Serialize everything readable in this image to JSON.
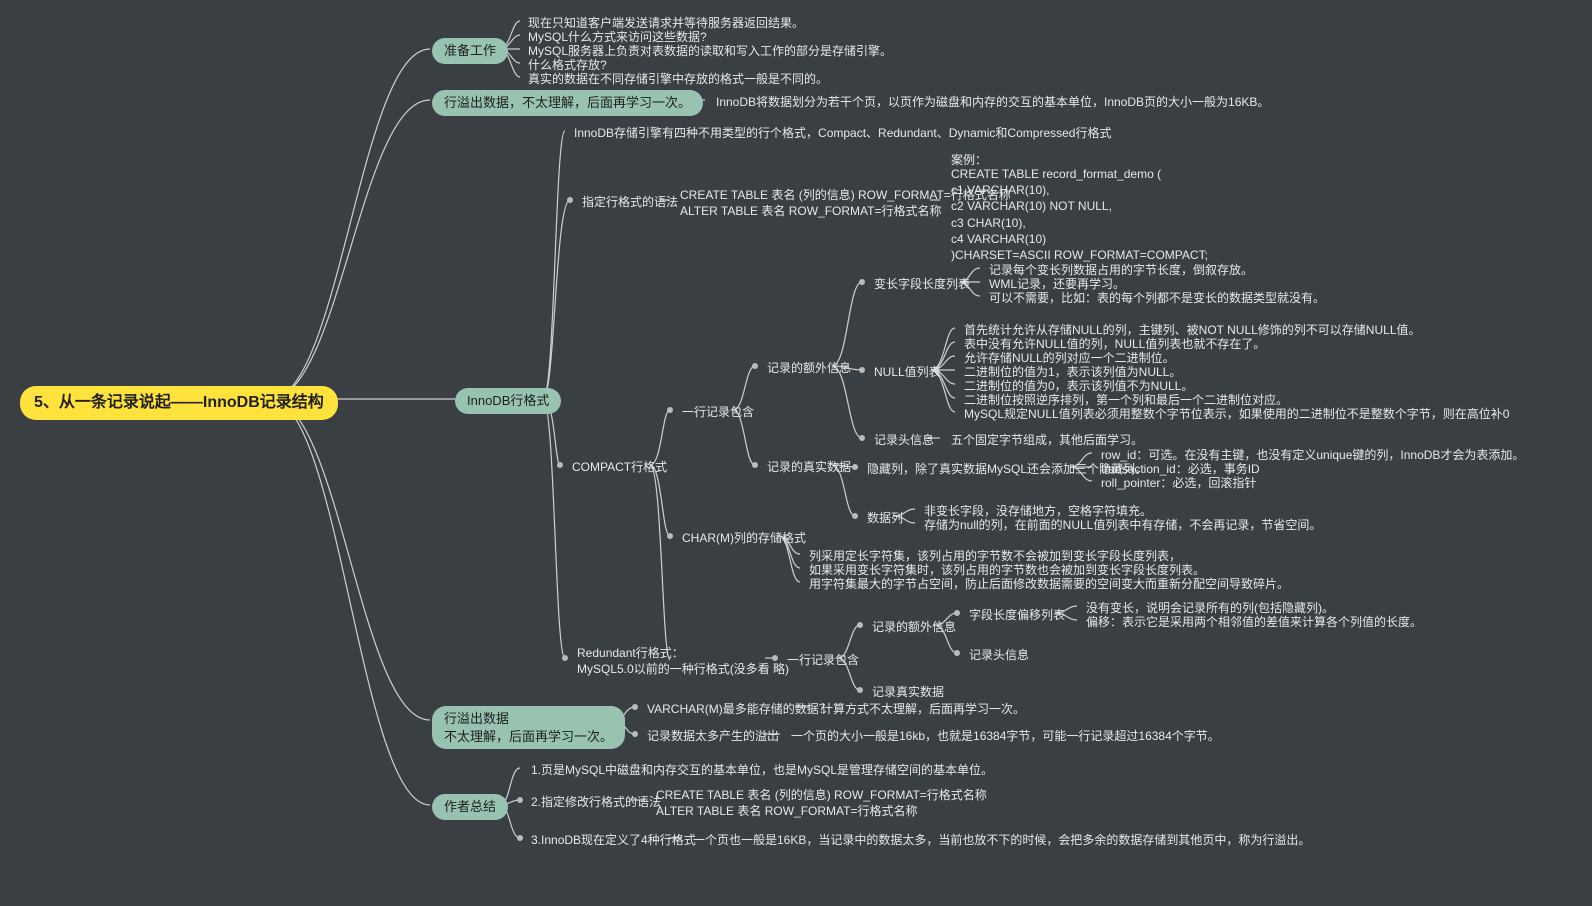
{
  "root": "5、从一条记录说起——InnoDB记录结构",
  "b1": {
    "title": "准备工作",
    "lines": [
      "现在只知道客户端发送请求并等待服务器返回结果。",
      "MySQL什么方式来访问这些数据?",
      "MySQL服务器上负责对表数据的读取和写入工作的部分是存储引擎。",
      "什么格式存放?",
      "真实的数据在不同存储引擎中存放的格式一般是不同的。"
    ]
  },
  "b2": {
    "title": "行溢出数据，不太理解，后面再学习一次。",
    "text": "InnoDB将数据划分为若干个页，以页作为磁盘和内存的交互的基本单位，InnoDB页的大小一般为16KB。"
  },
  "b3": {
    "title": "InnoDB行格式",
    "intro": "InnoDB存储引擎有四种不用类型的行个格式，Compact、Redundant、Dynamic和Compressed行格式",
    "syntax": {
      "title": "指定行格式的语法",
      "lines": "CREATE TABLE 表名 (列的信息) ROW_FORMAT=行格式名称\nALTER TABLE 表名 ROW_FORMAT=行格式名称",
      "example_label": "案例：",
      "example": "CREATE TABLE record_format_demo (\nc1 VARCHAR(10),\nc2 VARCHAR(10) NOT NULL,\nc3 CHAR(10),\nc4 VARCHAR(10)\n)CHARSET=ASCII ROW_FORMAT=COMPACT;"
    },
    "compact": {
      "title": "COMPACT行格式",
      "row_contains": "一行记录包含",
      "extra": "记录的额外信息",
      "varlen": {
        "title": "变长字段长度列表",
        "lines": [
          "记录每个变长列数据占用的字节长度，倒叙存放。",
          "WML记录，还要再学习。",
          "可以不需要，比如：表的每个列都不是变长的数据类型就没有。"
        ]
      },
      "nulls": {
        "title": "NULL值列表",
        "lines": [
          "首先统计允许从存储NULL的列，主键列、被NOT NULL修饰的列不可以存储NULL值。",
          "表中没有允许NULL值的列，NULL值列表也就不存在了。",
          "允许存储NULL的列对应一个二进制位。",
          "二进制位的值为1，表示该列值为NULL。",
          "二进制位的值为0，表示该列值不为NULL。",
          "二进制位按照逆序排列，第一个列和最后一个二进制位对应。",
          "MySQL规定NULL值列表必须用整数个字节位表示，如果使用的二进制位不是整数个字节，则在高位补0"
        ]
      },
      "header": {
        "title": "记录头信息",
        "text": "五个固定字节组成，其他后面学习。"
      },
      "real": {
        "title": "记录的真实数据",
        "hidden": {
          "title": "隐藏列，除了真实数据MySQL还会添加三个隐藏列。",
          "lines": [
            "row_id：可选。在没有主键，也没有定义unique键的列，InnoDB才会为表添加。",
            "transaction_id：必选，事务ID",
            "roll_pointer：必选，回滚指针"
          ]
        },
        "datacol": {
          "title": "数据列",
          "lines": [
            "非变长字段，没存储地方，空格字符填充。",
            "存储为null的列，在前面的NULL值列表中有存储，不会再记录，节省空间。"
          ]
        }
      },
      "charm": {
        "title": "CHAR(M)列的存储格式",
        "lines": [
          "列采用定长字符集，该列占用的字节数不会被加到变长字段长度列表，",
          "如果采用变长字符集时，该列占用的字节数也会被加到变长字段长度列表。",
          "用字符集最大的字节占空间，防止后面修改数据需要的空间变大而重新分配空间导致碎片。"
        ]
      }
    },
    "redundant": {
      "title": "Redundant行格式：\nMySQL5.0以前的一种行格式(没多看 略)",
      "row_contains": "一行记录包含",
      "extra": "记录的额外信息",
      "offset": {
        "title": "字段长度偏移列表",
        "lines": [
          "没有变长，说明会记录所有的列(包括隐藏列)。",
          "偏移：表示它是采用两个相邻值的差值来计算各个列值的长度。"
        ]
      },
      "header": "记录头信息",
      "real": "记录真实数据"
    }
  },
  "b4": {
    "title": "行溢出数据\n不太理解，后面再学习一次。",
    "varchar": {
      "title": "VARCHAR(M)最多能存储的数据？",
      "text": "计算方式不太理解，后面再学习一次。"
    },
    "overflow": {
      "title": "记录数据太多产生的溢出",
      "text": "一个页的大小一般是16kb，也就是16384字节，可能一行记录超过16384个字节。"
    }
  },
  "b5": {
    "title": "作者总结",
    "p1": "1.页是MySQL中磁盘和内存交互的基本单位，也是MySQL是管理存储空间的基本单位。",
    "p2": {
      "title": "2.指定修改行格式的语法",
      "lines": "CREATE TABLE 表名 (列的信息) ROW_FORMAT=行格式名称\nALTER TABLE 表名 ROW_FORMAT=行格式名称"
    },
    "p3": {
      "title": "3.InnoDB现在定义了4种行格式",
      "text": "一个页也一般是16KB，当记录中的数据太多，当前也放不下的时候，会把多余的数据存储到其他页中，称为行溢出。"
    }
  }
}
